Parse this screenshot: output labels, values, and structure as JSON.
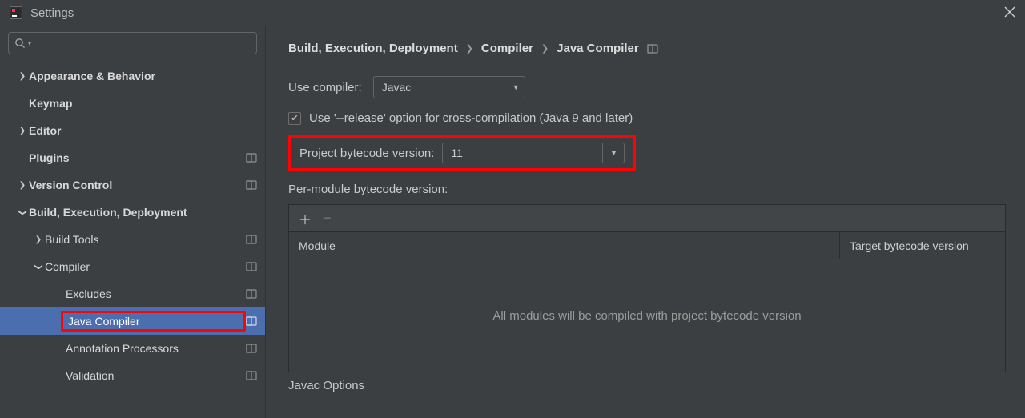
{
  "window": {
    "title": "Settings"
  },
  "search": {
    "placeholder": ""
  },
  "tree": {
    "appearance": "Appearance & Behavior",
    "keymap": "Keymap",
    "editor": "Editor",
    "plugins": "Plugins",
    "vcs": "Version Control",
    "bed": "Build, Execution, Deployment",
    "build_tools": "Build Tools",
    "compiler": "Compiler",
    "excludes": "Excludes",
    "java_compiler": "Java Compiler",
    "annotation": "Annotation Processors",
    "validation": "Validation"
  },
  "breadcrumb": {
    "a": "Build, Execution, Deployment",
    "b": "Compiler",
    "c": "Java Compiler"
  },
  "form": {
    "use_compiler_label": "Use compiler:",
    "use_compiler_value": "Javac",
    "release_option": "Use '--release' option for cross-compilation (Java 9 and later)",
    "project_bytecode_label": "Project bytecode version:",
    "project_bytecode_value": "11",
    "per_module_label": "Per-module bytecode version:",
    "col_module": "Module",
    "col_target": "Target bytecode version",
    "empty_msg": "All modules will be compiled with project bytecode version",
    "javac_options": "Javac Options"
  }
}
